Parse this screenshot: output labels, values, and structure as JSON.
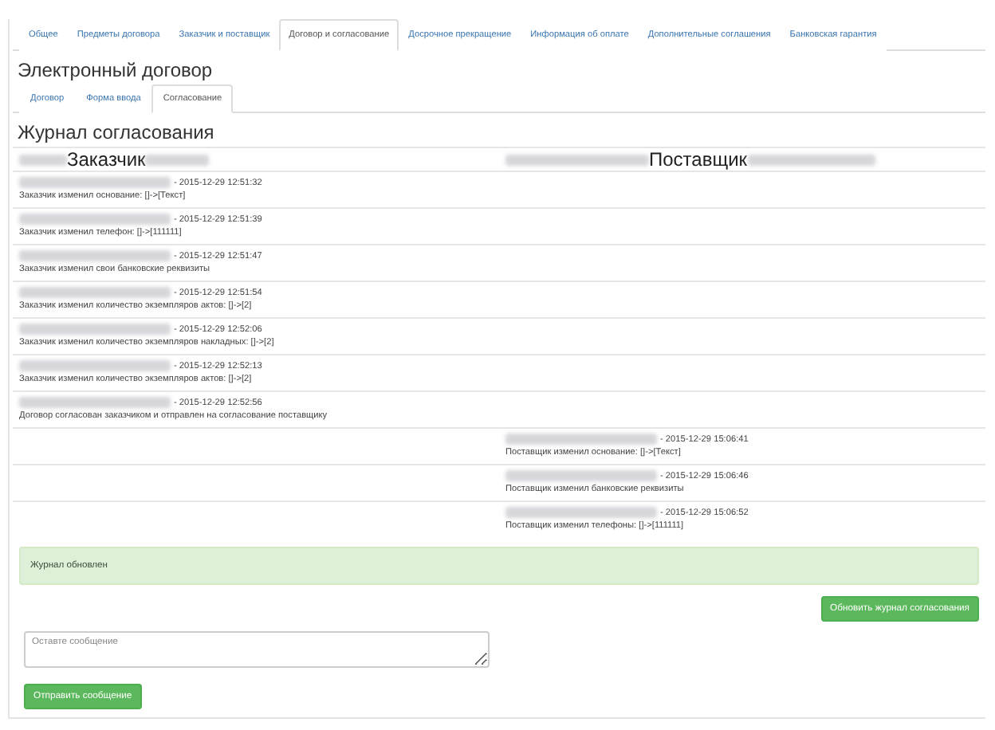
{
  "tabs": [
    {
      "label": "Общее",
      "selected": false
    },
    {
      "label": "Предметы договора",
      "selected": false
    },
    {
      "label": "Заказчик и поставщик",
      "selected": false
    },
    {
      "label": "Договор и согласование",
      "selected": true
    },
    {
      "label": "Досрочное прекращение",
      "selected": false
    },
    {
      "label": "Информация об оплате",
      "selected": false
    },
    {
      "label": "Дополнительные соглашения",
      "selected": false
    },
    {
      "label": "Банковская гарантия",
      "selected": false
    }
  ],
  "section_title": "Электронный договор",
  "subtabs": [
    {
      "label": "Договор",
      "selected": false
    },
    {
      "label": "Форма ввода",
      "selected": false
    },
    {
      "label": "Согласование",
      "selected": true
    }
  ],
  "journal": {
    "title": "Журнал согласования",
    "columns": [
      "Заказчик",
      "Поставщик"
    ],
    "rows": [
      {
        "kind": "customer",
        "time": "- 2015-12-29 12:51:32",
        "text": "Заказчик изменил основание: []->[Текст]"
      },
      {
        "kind": "customer",
        "time": "- 2015-12-29 12:51:39",
        "text": "Заказчик изменил телефон: []->[111111]"
      },
      {
        "kind": "customer",
        "time": "- 2015-12-29 12:51:47",
        "text": "Заказчик изменил свои банковские реквизиты"
      },
      {
        "kind": "customer",
        "time": "- 2015-12-29 12:51:54",
        "text": "Заказчик изменил количество экземпляров актов: []->[2]"
      },
      {
        "kind": "customer",
        "time": "- 2015-12-29 12:52:06",
        "text": "Заказчик изменил количество экземпляров накладных: []->[2]"
      },
      {
        "kind": "customer",
        "time": "- 2015-12-29 12:52:13",
        "text": "Заказчик изменил количество экземпляров актов: []->[2]"
      },
      {
        "kind": "customer",
        "time": "- 2015-12-29 12:52:56",
        "text": "Договор согласован заказчиком и отправлен на согласование поставщику"
      },
      {
        "kind": "supplier",
        "time": "- 2015-12-29 15:06:41",
        "text": "Поставщик изменил основание: []->[Текст]"
      },
      {
        "kind": "supplier",
        "time": "- 2015-12-29 15:06:46",
        "text": "Поставщик изменил банковские реквизиты"
      },
      {
        "kind": "supplier",
        "time": "- 2015-12-29 15:06:52",
        "text": "Поставщик изменил телефоны: []->[111111]"
      }
    ]
  },
  "alert": "Журнал обновлен",
  "refresh_button": "Обновить журнал согласования",
  "message": {
    "placeholder": "Оставте сообщение"
  },
  "send_button": "Отправить сообщение"
}
